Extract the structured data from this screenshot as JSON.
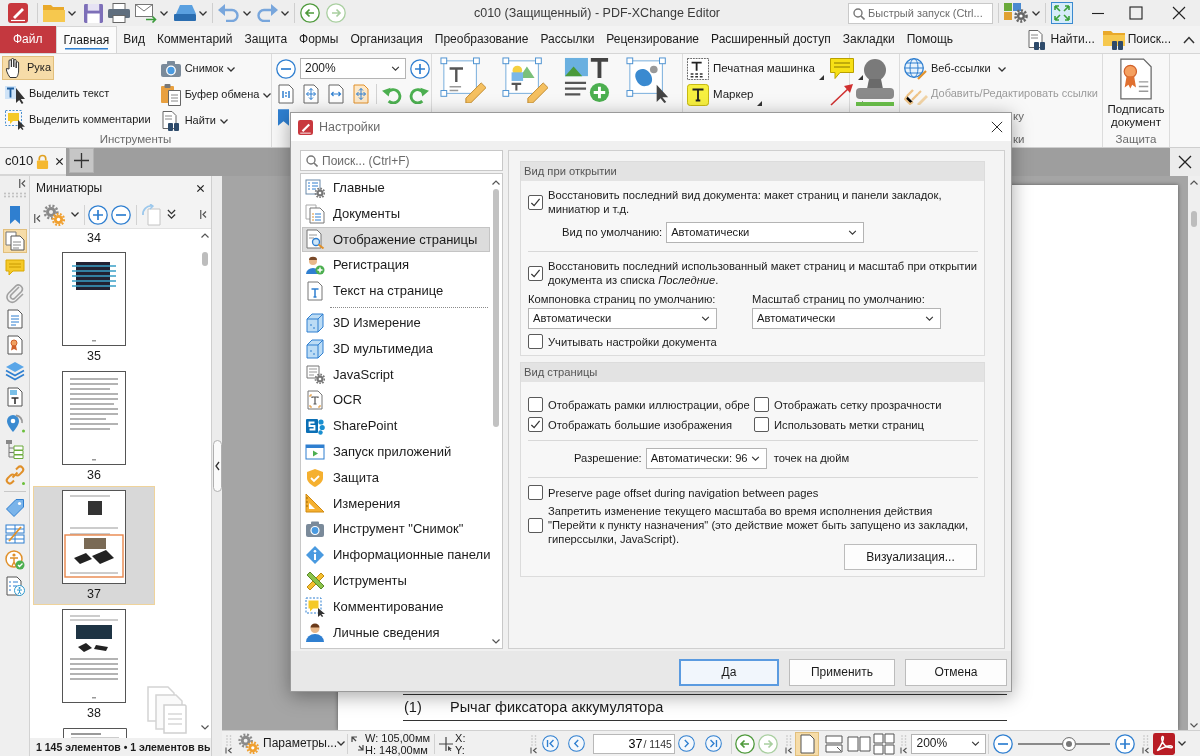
{
  "window": {
    "title": "c010 (Защищенный) - PDF-XChange Editor",
    "navigation": [
      {
        "disabled": false
      },
      {
        "disabled": true
      }
    ],
    "quick_launch": {
      "placeholder": "Быстрый запуск (Ctrl..."
    }
  },
  "menu": {
    "file": "Файл",
    "tabs": [
      {
        "label": "Главная",
        "selected": true
      },
      {
        "label": "Вид",
        "selected": false
      },
      {
        "label": "Комментарий",
        "selected": false
      },
      {
        "label": "Защита",
        "selected": false
      },
      {
        "label": "Формы",
        "selected": false
      },
      {
        "label": "Организация",
        "selected": false
      },
      {
        "label": "Преобразование",
        "selected": false
      },
      {
        "label": "Рассылки",
        "selected": false
      },
      {
        "label": "Рецензирование",
        "selected": false
      },
      {
        "label": "Расширенный доступ",
        "selected": false
      },
      {
        "label": "Закладки",
        "selected": false
      },
      {
        "label": "Помощь",
        "selected": false
      }
    ],
    "commands": [
      "Найти...",
      "Поиск..."
    ]
  },
  "ribbon": {
    "tools": {
      "buttons": [
        {
          "label": "Рука",
          "selected": true
        },
        {
          "label": "Выделить текст",
          "selected": false
        },
        {
          "label": "Выделить комментарии",
          "selected": false
        }
      ],
      "menus": [
        "Снимок",
        "Буфер обмена",
        "Найти"
      ],
      "group_label": "Инструменты"
    },
    "zoom": {
      "value": "200%"
    },
    "annotations": [
      "Печатная машинка",
      "Маркер"
    ],
    "links": {
      "buttons": [
        {
          "label": "Веб-ссылки",
          "disabled": false
        },
        {
          "label": "Добавить/Редактировать ссылки",
          "disabled": true
        }
      ],
      "partial_item": "ку",
      "partial_group_label": "ки"
    },
    "protection": {
      "button": "Подписать документ",
      "group_label": "Защита"
    }
  },
  "document_tabs": [
    {
      "label": "c010"
    }
  ],
  "sidebar": {
    "groups": [
      {
        "items": [
          {
            "selected": false
          },
          {
            "selected": true
          },
          {
            "selected": false
          },
          {
            "selected": false
          },
          {
            "selected": false
          },
          {
            "selected": false
          },
          {
            "selected": false
          },
          {
            "selected": false
          },
          {
            "selected": false
          },
          {
            "selected": false
          },
          {
            "selected": false
          }
        ]
      },
      {
        "items": [
          {
            "selected": false
          },
          {
            "selected": false
          },
          {
            "selected": false
          },
          {
            "selected": false
          }
        ]
      }
    ]
  },
  "thumbnails": {
    "title": "Миниатюры",
    "pages": [
      {
        "label": "34",
        "selected": false
      },
      {
        "label": "35",
        "selected": false
      },
      {
        "label": "36",
        "selected": false
      },
      {
        "label": "37",
        "selected": true
      },
      {
        "label": "38",
        "selected": false
      }
    ],
    "footer": "1 145 элементов • 1 элементов вь"
  },
  "document": {
    "lines": [
      {
        "number": "(1)",
        "text": "Рычаг фиксатора аккумулятора"
      }
    ]
  },
  "status_bar": {
    "options": "Параметры...",
    "width": "W: 105,00мм",
    "height": "H: 148,00мм",
    "x": "X:",
    "y": "Y:",
    "page": "37",
    "page_total": "/ 1145",
    "navigation": [
      {
        "disabled": false
      },
      {
        "disabled": true
      }
    ],
    "views": [
      {
        "selected": true
      },
      {
        "selected": false
      },
      {
        "selected": false
      },
      {
        "selected": false
      }
    ],
    "zoom": "200%",
    "zoom_slider": {
      "level": 0.55
    }
  },
  "dialog": {
    "title": "Настройки",
    "search": {
      "placeholder": "Поиск... (Ctrl+F)"
    },
    "categories": [
      {
        "items": [
          {
            "label": "Главные",
            "selected": false
          },
          {
            "label": "Документы",
            "selected": false
          },
          {
            "label": "Отображение страницы",
            "selected": true
          },
          {
            "label": "Регистрация",
            "selected": false
          },
          {
            "label": "Текст на странице",
            "selected": false
          }
        ]
      },
      {
        "items": [
          {
            "label": "3D Измерение",
            "selected": false
          },
          {
            "label": "3D мультимедиа",
            "selected": false
          },
          {
            "label": "JavaScript",
            "selected": false
          },
          {
            "label": "OCR",
            "selected": false
          },
          {
            "label": "SharePoint",
            "selected": false
          },
          {
            "label": "Запуск приложений",
            "selected": false
          },
          {
            "label": "Защита",
            "selected": false
          },
          {
            "label": "Измерения",
            "selected": false
          },
          {
            "label": "Инструмент \"Снимок\"",
            "selected": false
          },
          {
            "label": "Информационные панели",
            "selected": false
          },
          {
            "label": "Иструменты",
            "selected": false
          },
          {
            "label": "Комментирование",
            "selected": false
          },
          {
            "label": "Личные сведения",
            "selected": false
          }
        ]
      }
    ],
    "sections": [
      {
        "title": "Вид при открытии",
        "rows": [
          {
            "kind": "checkbox",
            "label": "Восстановить последний вид документа: макет страниц и панели закладок, миниатюр и т.д.",
            "checked": true
          },
          {
            "kind": "select",
            "label": "Вид по умолчанию:",
            "value": "Автоматически"
          },
          {
            "kind": "divider"
          },
          {
            "kind": "checkbox",
            "label": "Восстановить последний использованный макет страниц и масштаб при открытии документа из списка *Последние*.",
            "checked": true
          },
          {
            "kind": "select_pair",
            "fields": [
              {
                "label": "Компоновка страниц по умолчанию:",
                "value": "Автоматически"
              },
              {
                "label": "Масштаб страниц по умолчанию:",
                "value": "Автоматически"
              }
            ]
          },
          {
            "kind": "checkbox",
            "label": "Учитывать настройки документа",
            "checked": false
          }
        ]
      },
      {
        "title": "Вид страницы",
        "rows": [
          {
            "kind": "checkbox_grid",
            "items": [
              {
                "label": "Отображать рамки иллюстрации, обре",
                "checked": false
              },
              {
                "label": "Отображать сетку прозрачности",
                "checked": false
              },
              {
                "label": "Отображать большие изображения",
                "checked": true
              },
              {
                "label": "Использовать метки страниц",
                "checked": false
              }
            ]
          },
          {
            "kind": "divider"
          },
          {
            "kind": "select",
            "label": "Разрешение:",
            "value": "Автоматически: 96",
            "unit": "точек на дюйм"
          },
          {
            "kind": "divider"
          },
          {
            "kind": "checkbox",
            "label": "Preserve page offset during navigation between pages",
            "checked": false
          },
          {
            "kind": "checkbox",
            "label": "Запретить изменение текущего масштаба во время исполнения действия \"Перейти к пункту назначения\" (это действие может быть запущено из закладки, гиперссылки, JavaScript).",
            "checked": false
          },
          {
            "kind": "button",
            "label": "Визуализация..."
          }
        ]
      }
    ],
    "buttons": [
      {
        "label": "Да",
        "default": true
      },
      {
        "label": "Применить",
        "default": false
      },
      {
        "label": "Отмена",
        "default": false
      }
    ]
  }
}
